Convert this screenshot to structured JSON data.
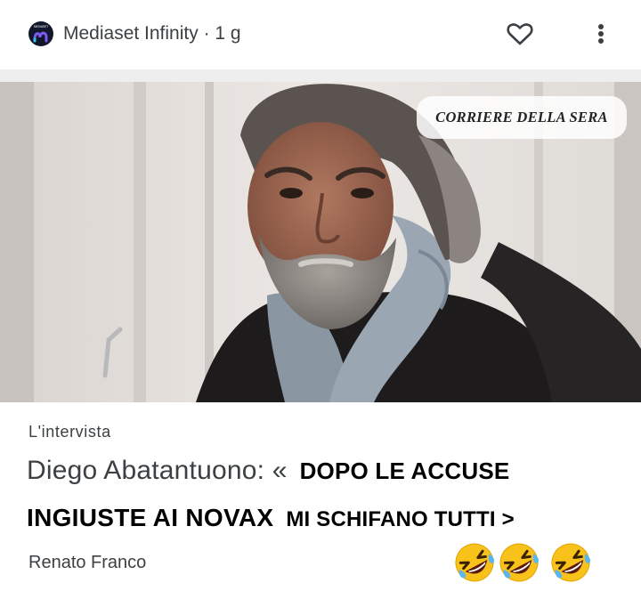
{
  "post": {
    "source": "Mediaset Infinity",
    "age": "1 g",
    "separator": " · ",
    "logo_text": "MEDIASET"
  },
  "article": {
    "newspaper_label": "CORRIERE DELLA SERA",
    "kicker": "L'intervista",
    "headline_part1": "Diego Abatantuono: «",
    "headline_part2": "DOPO LE ACCUSE",
    "headline_part3": "INGIUSTE AI NOVAX",
    "headline_part4": "MI SCHIFANO TUTTI >",
    "author": "Renato Franco"
  },
  "icons": {
    "like": "heart-outline-icon",
    "more": "more-vertical-icon",
    "reaction": "rolling-on-floor-laughing-emoji",
    "reaction_count": 3
  },
  "colors": {
    "text_primary": "#202124",
    "text_secondary": "#3c4043",
    "divider": "#eeeeee",
    "emoji_face": "#f9c21b"
  }
}
